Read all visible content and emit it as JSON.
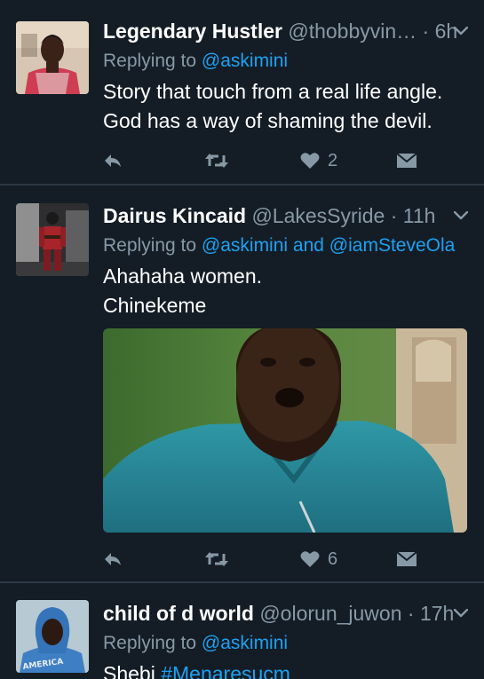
{
  "tweets": [
    {
      "name": "Legendary Hustler",
      "handle": "@thobbyvin…",
      "time": "· 6h",
      "replying_label": "Replying to ",
      "mentions": [
        "@askimini"
      ],
      "mention_joiner": "",
      "text_lines": [
        "Story that touch from a real life angle.",
        "God has a way of shaming the devil."
      ],
      "like_count": "2"
    },
    {
      "name": "Dairus Kincaid",
      "handle": "@LakesSyride",
      "time": "· 11h",
      "replying_label": "Replying to ",
      "mentions": [
        "@askimini",
        "@iamSteveOla"
      ],
      "mention_joiner": " and ",
      "text_lines": [
        "Ahahaha women.",
        "Chinekeme"
      ],
      "like_count": "6"
    },
    {
      "name": "child of d world",
      "handle": "@olorun_juwon",
      "time": "· 17h",
      "replying_label": "Replying to ",
      "mentions": [
        "@askimini"
      ],
      "text_prefix": "Shebi ",
      "hashtag": "#Menaresucm"
    }
  ],
  "avatar3_shirt_text": "AMERICA"
}
